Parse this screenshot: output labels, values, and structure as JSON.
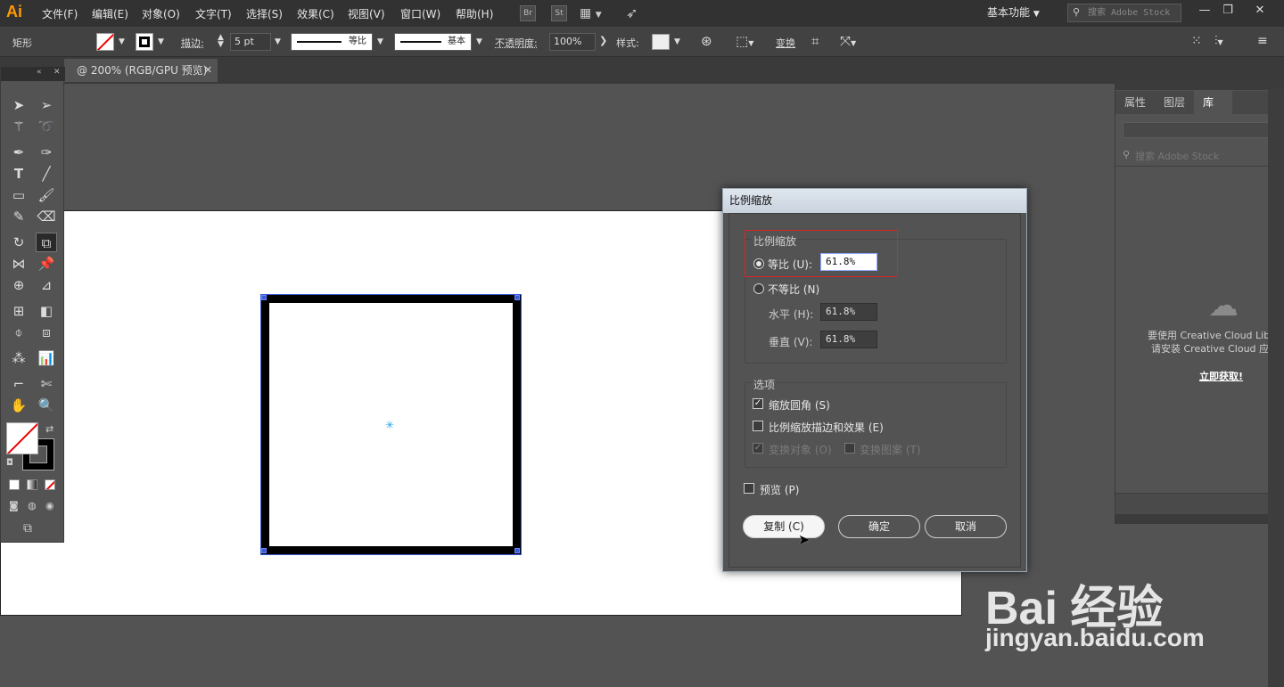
{
  "app": {
    "logo": "Ai"
  },
  "menu": [
    "文件(F)",
    "编辑(E)",
    "对象(O)",
    "文字(T)",
    "选择(S)",
    "效果(C)",
    "视图(V)",
    "窗口(W)",
    "帮助(H)"
  ],
  "menubar_icons": {
    "bridge": "Br",
    "stock": "St"
  },
  "workspace": "基本功能",
  "search_stock_placeholder": "搜索 Adobe Stock",
  "control": {
    "object_type": "矩形",
    "stroke_label": "描边:",
    "stroke_value": "5 pt",
    "profile1": "等比",
    "profile2": "基本",
    "opacity_label": "不透明度:",
    "opacity_value": "100%",
    "style_label": "样式:",
    "transform_label": "变换"
  },
  "doc_tab": {
    "title": "@ 200% (RGB/GPU 预览)"
  },
  "panel": {
    "tabs": [
      "属性",
      "图层",
      "库"
    ],
    "search_placeholder": "搜索 Adobe Stock",
    "msg1": "要使用 Creative Cloud Librar",
    "msg2": "请安装 Creative Cloud 应用程",
    "link": "立即获取!"
  },
  "dialog": {
    "title": "比例缩放",
    "section_scale": "比例缩放",
    "uniform_label": "等比 (U):",
    "uniform_value": "61.8%",
    "nonuniform_label": "不等比 (N)",
    "horizontal_label": "水平 (H):",
    "horizontal_value": "61.8%",
    "vertical_label": "垂直 (V):",
    "vertical_value": "61.8%",
    "section_options": "选项",
    "opt_corners": "缩放圆角 (S)",
    "opt_strokes": "比例缩放描边和效果 (E)",
    "opt_objects": "变换对象 (O)",
    "opt_patterns": "变换图案 (T)",
    "preview": "预览 (P)",
    "btn_copy": "复制 (C)",
    "btn_ok": "确定",
    "btn_cancel": "取消"
  },
  "state": {
    "uniform_selected": true,
    "scale_corners": true,
    "scale_strokes": false,
    "transform_objects": true,
    "transform_patterns": false,
    "preview": false
  },
  "watermark": {
    "brand": "Bai  经验",
    "url": "jingyan.baidu.com"
  },
  "colors": {
    "accent": "#ff9a00",
    "selection": "#3b5bd6",
    "highlight_box": "#dd2222"
  }
}
